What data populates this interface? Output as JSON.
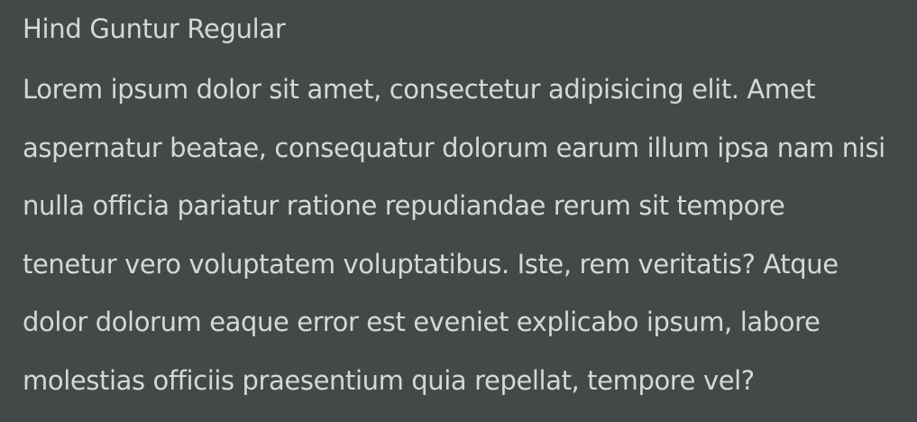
{
  "font_name": "Hind Guntur Regular",
  "sample_text_lines": [
    "Lorem ipsum dolor sit amet, consectetur adipisicing elit. Amet",
    "aspernatur beatae, consequatur dolorum earum illum ipsa nam nisi",
    "nulla officia pariatur ratione repudiandae rerum sit tempore",
    "tenetur vero voluptatem voluptatibus. Iste, rem veritatis? Atque",
    "dolor dolorum eaque error est eveniet explicabo ipsum, labore",
    "molestias officiis praesentium quia repellat, tempore vel?"
  ],
  "colors": {
    "background": "#454849",
    "text": "#d6d8d8"
  }
}
